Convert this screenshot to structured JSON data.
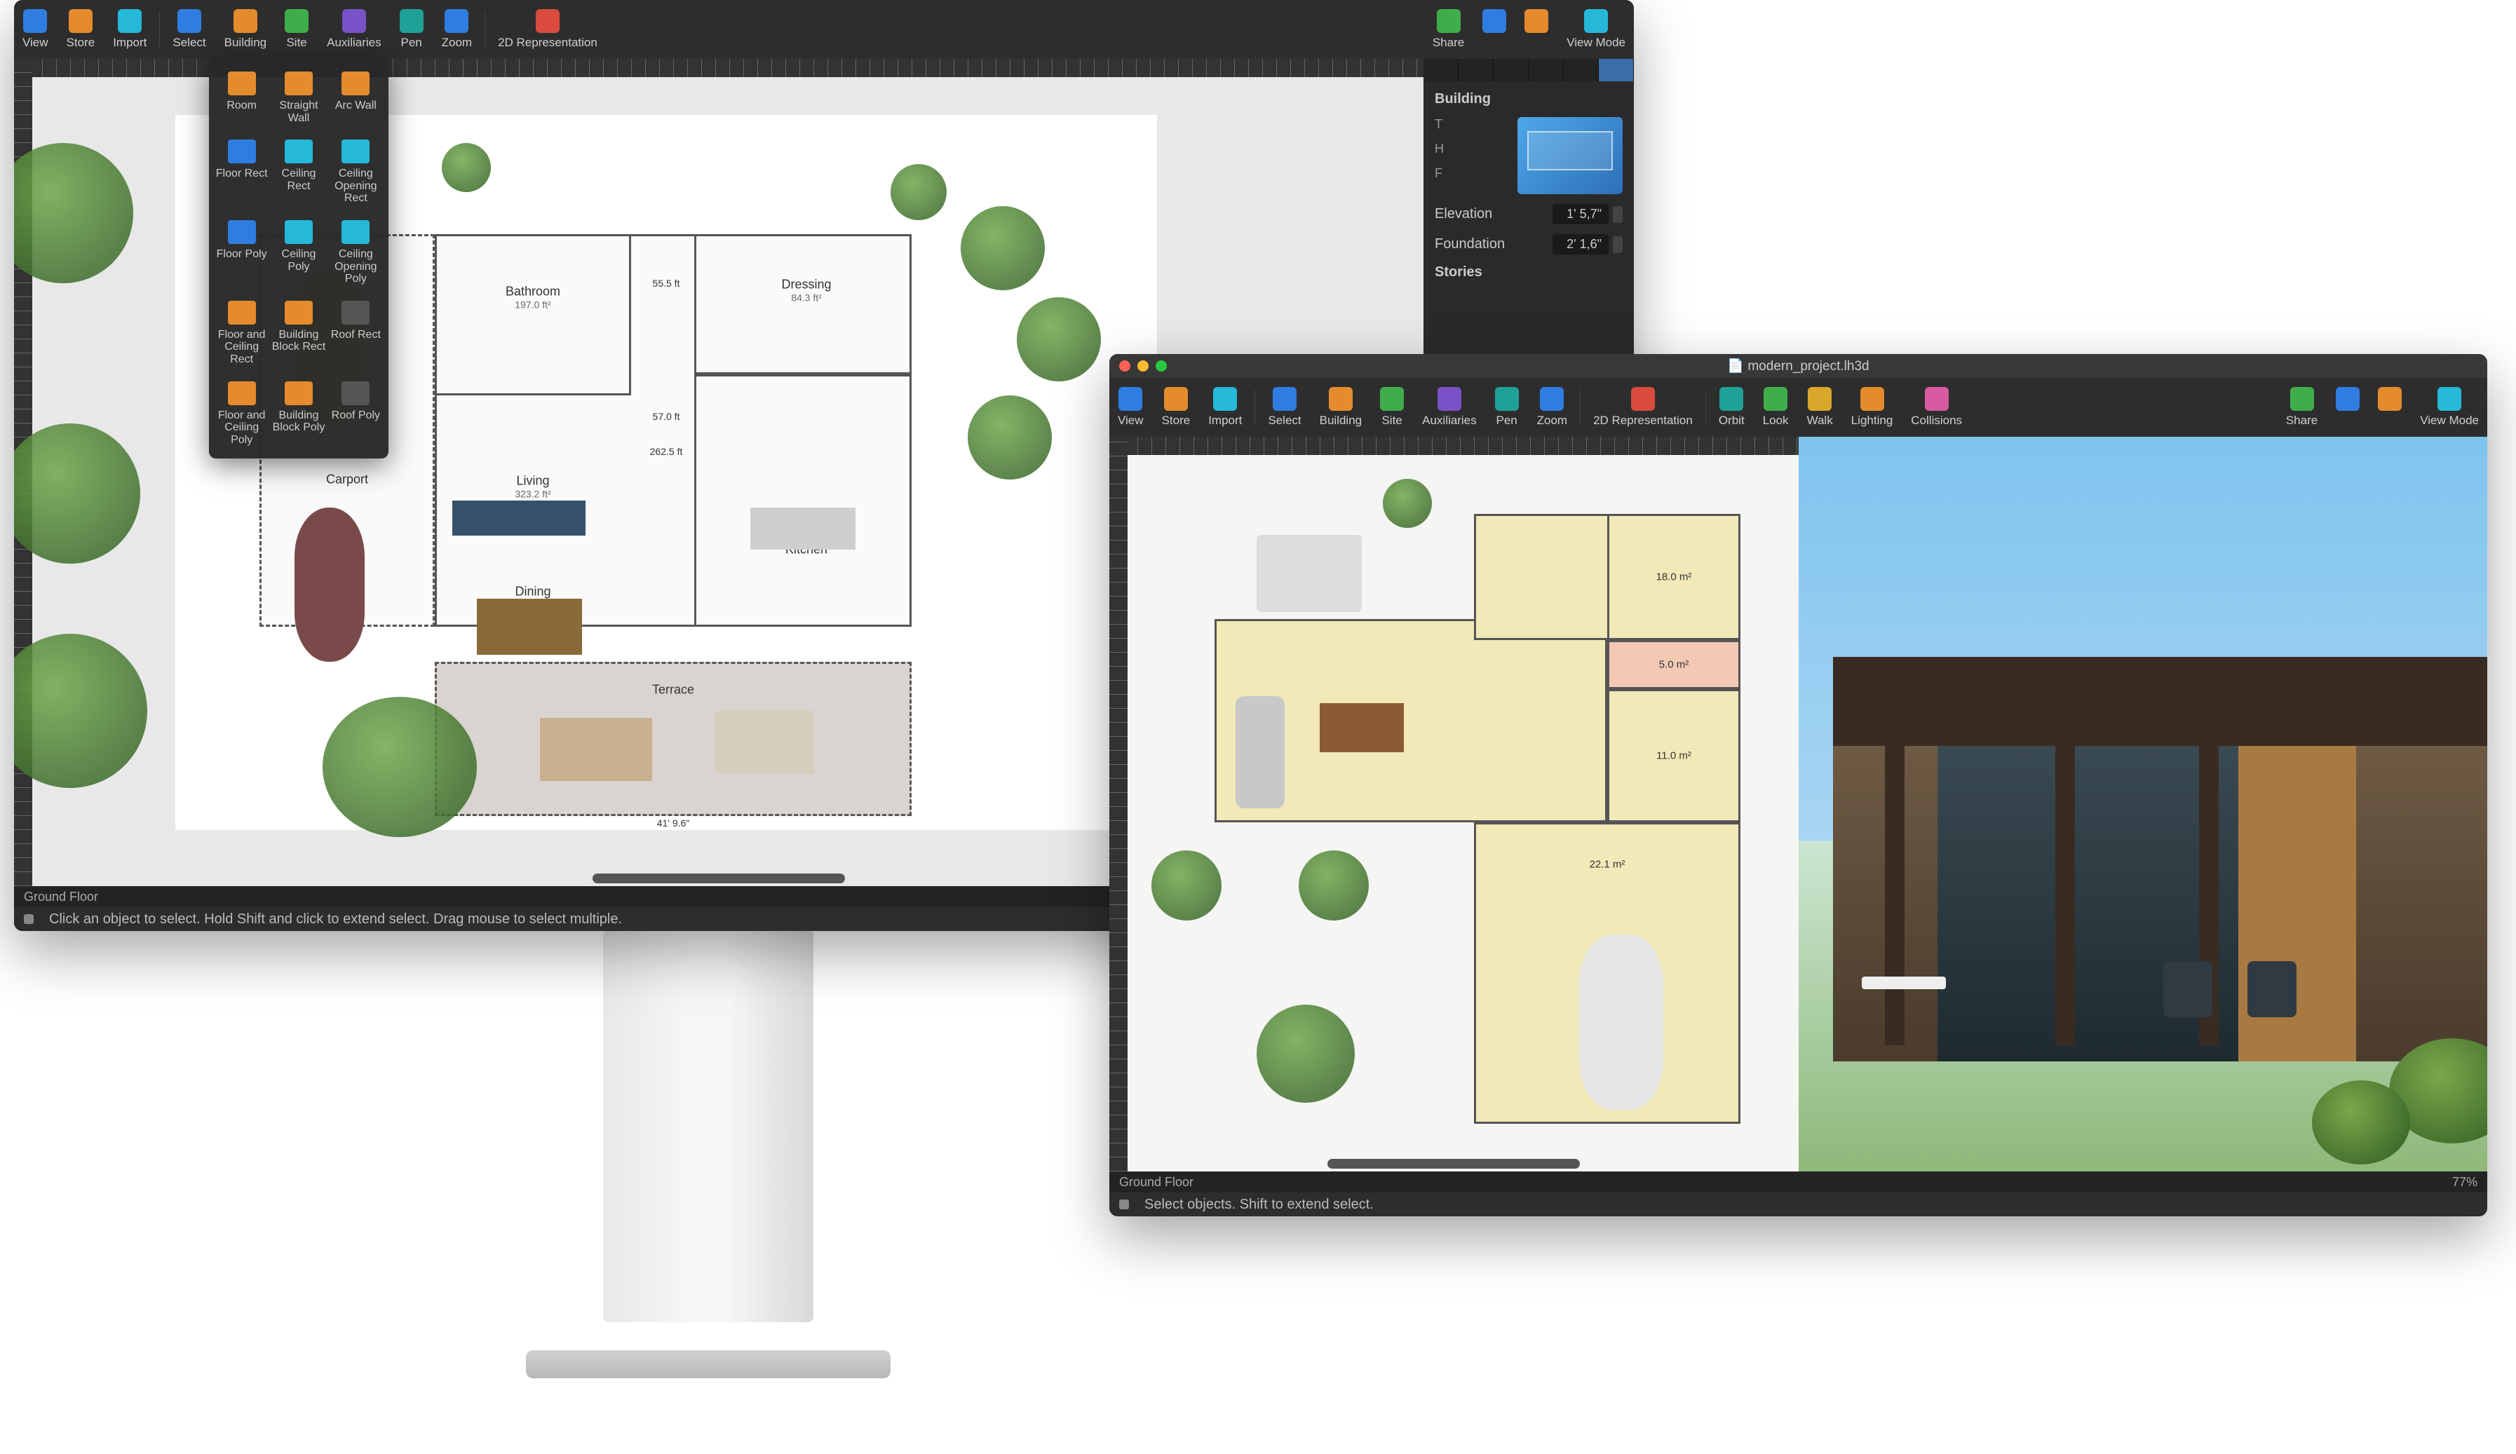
{
  "window1": {
    "toolbar_left": [
      {
        "label": "View",
        "color": "i-blue"
      },
      {
        "label": "Store",
        "color": "i-orange"
      },
      {
        "label": "Import",
        "color": "i-cyan"
      }
    ],
    "toolbar_mid": [
      {
        "label": "Select",
        "color": "i-blue"
      },
      {
        "label": "Building",
        "color": "i-orange"
      },
      {
        "label": "Site",
        "color": "i-green"
      },
      {
        "label": "Auxiliaries",
        "color": "i-purple"
      },
      {
        "label": "Pen",
        "color": "i-teal"
      },
      {
        "label": "Zoom",
        "color": "i-blue"
      }
    ],
    "toolbar_rep": "2D Representation",
    "toolbar_right": [
      {
        "label": "Share",
        "color": "i-green"
      },
      {
        "label": "",
        "color": "i-blue"
      },
      {
        "label": "",
        "color": "i-orange"
      },
      {
        "label": "View Mode",
        "color": "i-cyan"
      }
    ],
    "popover": [
      "Room",
      "Straight Wall",
      "Arc Wall",
      "Floor Rect",
      "Ceiling Rect",
      "Ceiling Opening Rect",
      "Floor Poly",
      "Ceiling Poly",
      "Ceiling Opening Poly",
      "Floor and Ceiling Rect",
      "Building Block Rect",
      "Roof Rect",
      "Floor and Ceiling Poly",
      "Building Block Poly",
      "Roof Poly"
    ],
    "popover_colors": [
      "i-orange",
      "i-orange",
      "i-orange",
      "i-blue",
      "i-cyan",
      "i-cyan",
      "i-blue",
      "i-cyan",
      "i-cyan",
      "i-orange",
      "i-orange",
      "i-grey",
      "i-orange",
      "i-orange",
      "i-grey"
    ],
    "inspector": {
      "title": "Building",
      "axis": [
        "T",
        "H",
        "F"
      ],
      "rows": [
        {
          "label": "Elevation",
          "value": "1' 5,7\""
        },
        {
          "label": "Foundation",
          "value": "2' 1,6\""
        }
      ],
      "section": "Stories"
    },
    "plan": {
      "rooms": [
        {
          "name": "Bathroom",
          "area": "197.0 ft²"
        },
        {
          "name": "Living",
          "area": "323.2 ft²"
        },
        {
          "name": "Dining",
          "area": ""
        },
        {
          "name": "Kitchen",
          "area": ""
        },
        {
          "name": "Dressing",
          "area": "84.3 ft²"
        },
        {
          "name": "Carport",
          "area": ""
        },
        {
          "name": "Terrace",
          "area": ""
        }
      ],
      "dims": [
        "55.5 ft",
        "57.0 ft",
        "262.5 ft",
        "41' 9.6\""
      ]
    },
    "floor_label": "Ground Floor",
    "status": "Click an object to select. Hold Shift and click to extend select. Drag mouse to select multiple."
  },
  "window2": {
    "title": "modern_project.lh3d",
    "toolbar_left": [
      {
        "label": "View",
        "color": "i-blue"
      },
      {
        "label": "Store",
        "color": "i-orange"
      },
      {
        "label": "Import",
        "color": "i-cyan"
      }
    ],
    "toolbar_mid": [
      {
        "label": "Select",
        "color": "i-blue"
      },
      {
        "label": "Building",
        "color": "i-orange"
      },
      {
        "label": "Site",
        "color": "i-green"
      },
      {
        "label": "Auxiliaries",
        "color": "i-purple"
      },
      {
        "label": "Pen",
        "color": "i-teal"
      },
      {
        "label": "Zoom",
        "color": "i-blue"
      }
    ],
    "toolbar_rep": "2D Representation",
    "toolbar_nav": [
      {
        "label": "Orbit",
        "color": "i-teal"
      },
      {
        "label": "Look",
        "color": "i-green"
      },
      {
        "label": "Walk",
        "color": "i-yellow"
      },
      {
        "label": "Lighting",
        "color": "i-orange"
      },
      {
        "label": "Collisions",
        "color": "i-pink"
      }
    ],
    "toolbar_right": [
      {
        "label": "Share",
        "color": "i-green"
      },
      {
        "label": "",
        "color": "i-blue"
      },
      {
        "label": "",
        "color": "i-orange"
      },
      {
        "label": "View Mode",
        "color": "i-cyan"
      }
    ],
    "plan": {
      "areas": [
        "18.0 m²",
        "5.0 m²",
        "11.0 m²",
        "22.1 m²"
      ]
    },
    "floor_label": "Ground Floor",
    "zoom": "77%",
    "status": "Select objects. Shift to extend select."
  }
}
